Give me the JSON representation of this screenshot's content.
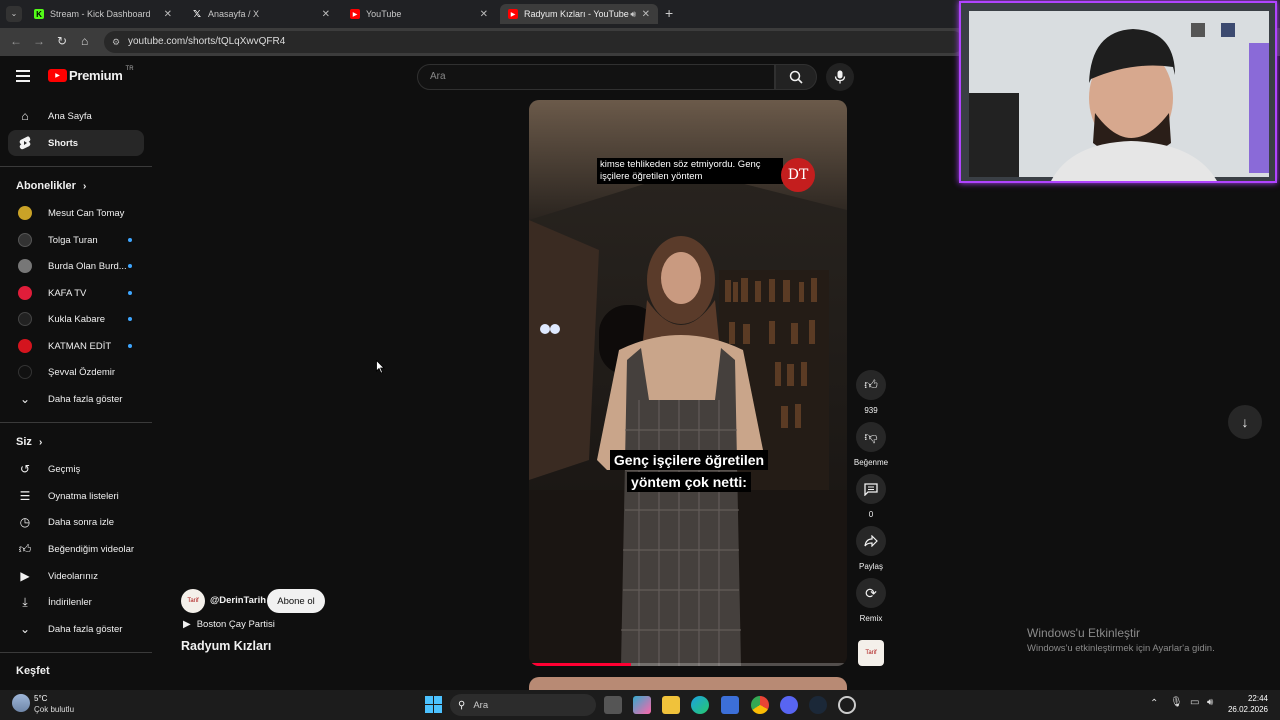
{
  "browser": {
    "tabs": [
      {
        "label": "Stream - Kick Dashboard",
        "icon": "kick-icon"
      },
      {
        "label": "Anasayfa / X",
        "icon": "x-icon"
      },
      {
        "label": "YouTube",
        "icon": "youtube-icon"
      },
      {
        "label": "Radyum Kızları - YouTube",
        "icon": "youtube-icon"
      }
    ],
    "url": "youtube.com/shorts/tQLqXwvQFR4"
  },
  "youtube": {
    "logo_text": "Premium",
    "logo_region": "TR",
    "search_placeholder": "Ara"
  },
  "sidebar": {
    "main": [
      {
        "label": "Ana Sayfa",
        "icon": "home-icon"
      },
      {
        "label": "Shorts",
        "icon": "shorts-icon"
      }
    ],
    "subscriptions_title": "Abonelikler",
    "subscriptions": [
      {
        "label": "Mesut Can Tomay",
        "color": "#c9a227",
        "new": false
      },
      {
        "label": "Tolga Turan",
        "color": "#333333",
        "new": true
      },
      {
        "label": "Burda Olan Burd...",
        "color": "#777777",
        "new": true
      },
      {
        "label": "KAFA TV",
        "color": "#e01d3a",
        "new": true
      },
      {
        "label": "Kukla Kabare",
        "color": "#222222",
        "new": true
      },
      {
        "label": "KATMAN EDİT",
        "color": "#d4141e",
        "new": true
      },
      {
        "label": "Şevval Özdemir",
        "color": "#111111",
        "new": false
      }
    ],
    "show_more_1": "Daha fazla göster",
    "you_title": "Siz",
    "you_items": [
      {
        "label": "Geçmiş",
        "icon": "history-icon"
      },
      {
        "label": "Oynatma listeleri",
        "icon": "playlist-icon"
      },
      {
        "label": "Daha sonra izle",
        "icon": "clock-icon"
      },
      {
        "label": "Beğendiğim videolar",
        "icon": "thumbs-up-icon"
      },
      {
        "label": "Videolarınız",
        "icon": "video-icon"
      },
      {
        "label": "İndirilenler",
        "icon": "download-icon"
      }
    ],
    "show_more_2": "Daha fazla göster",
    "explore_title": "Keşfet"
  },
  "short": {
    "top_caption": "kimse tehlikeden söz etmiyordu. Genç işçilere öğretilen yöntem",
    "logo_mark": "DT",
    "bottom_caption_line1": "Genç işçilere öğretilen",
    "bottom_caption_line2": "yöntem çok netti:",
    "progress": 0.32,
    "channel_handle": "@DerinTarih",
    "channel_avatar_text": "Tarif",
    "subscribe_label": "Abone ol",
    "music_label": "Boston Çay Partisi",
    "title": "Radyum Kızları"
  },
  "actions": {
    "like_count": "939",
    "dislike_label": "Beğenme",
    "comment_count": "0",
    "share_label": "Paylaş",
    "remix_label": "Remix"
  },
  "windows_watermark": {
    "line1": "Windows'u Etkinleştir",
    "line2": "Windows'u etkinleştirmek için Ayarlar'a gidin."
  },
  "taskbar": {
    "weather_temp": "5°C",
    "weather_desc": "Çok bulutlu",
    "search_label": "Ara",
    "time": "22:44",
    "date": "26.02.2026"
  }
}
